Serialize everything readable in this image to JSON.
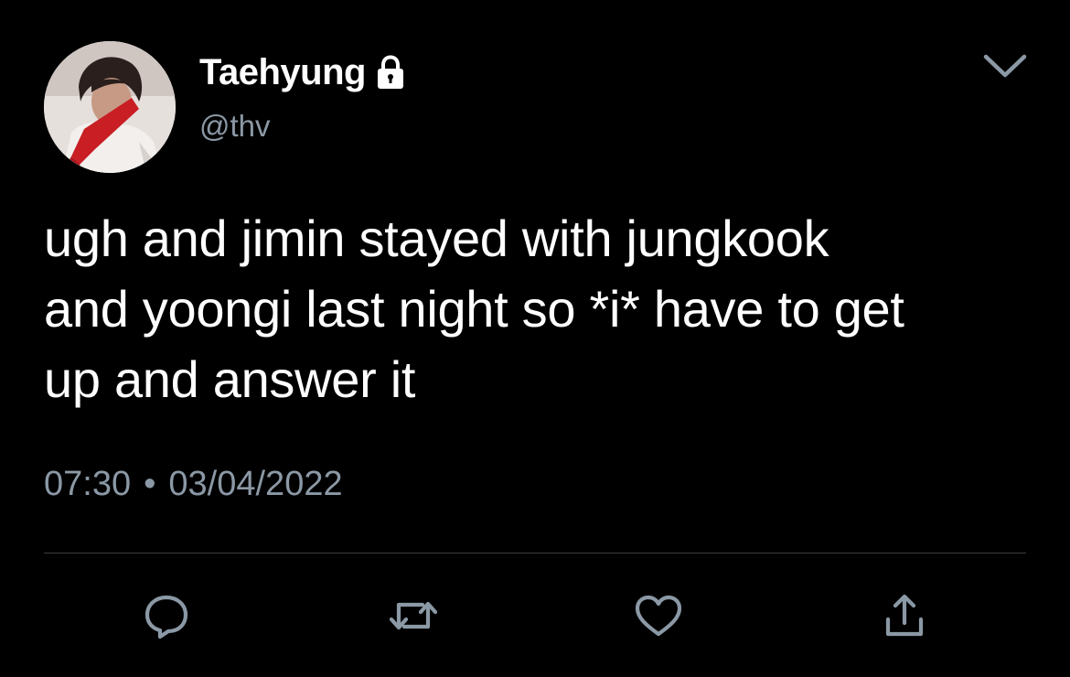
{
  "tweet": {
    "author": {
      "display_name": "Taehyung",
      "handle": "@thv",
      "protected_icon": "lock-icon"
    },
    "menu_icon": "chevron-down-icon",
    "text": "ugh and jimin stayed with jungkook\nand yoongi last night so *i* have to get\nup and answer it",
    "time": "07:30",
    "separator": "•",
    "date": "03/04/2022",
    "actions": [
      {
        "name": "reply",
        "icon": "reply-icon"
      },
      {
        "name": "retweet",
        "icon": "retweet-icon"
      },
      {
        "name": "like",
        "icon": "heart-icon"
      },
      {
        "name": "share",
        "icon": "share-icon"
      }
    ]
  },
  "colors": {
    "background": "#000000",
    "text_primary": "#ffffff",
    "text_secondary": "#8b98a5",
    "divider": "#3a3d42",
    "icon": "#8b98a5"
  }
}
